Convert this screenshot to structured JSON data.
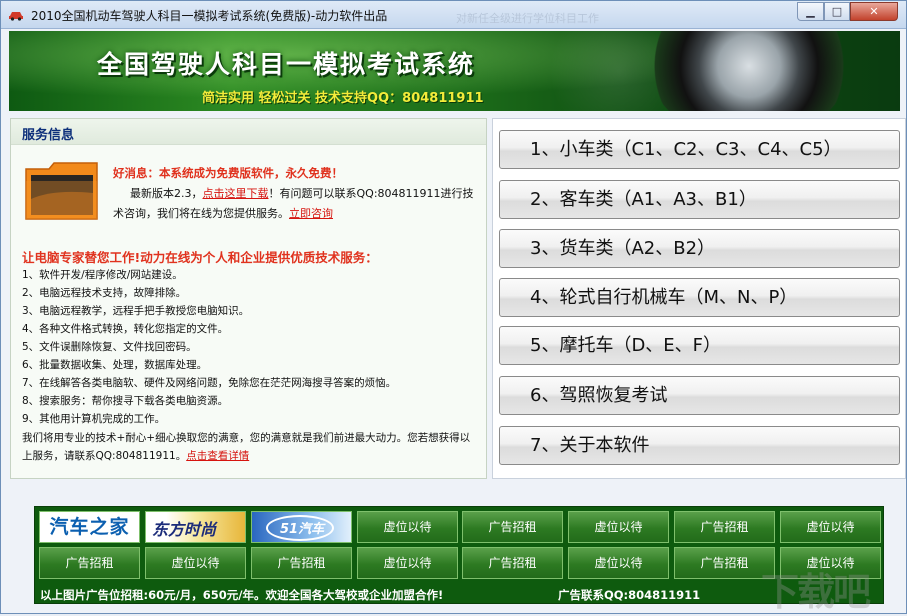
{
  "window": {
    "title": "2010全国机动车驾驶人科目一模拟考试系统(免费版)-动力软件出品",
    "ghost_text": "对新任全级进行学位科目工作",
    "close_label": "✕",
    "max_label": "□",
    "min_label": "▁"
  },
  "banner": {
    "title": "全国驾驶人科目一模拟考试系统",
    "subtitle": "简洁实用  轻松过关  技术支持QQ：804811911"
  },
  "service": {
    "header": "服务信息",
    "good_news": "好消息：本系统成为免费版软件，永久免费！",
    "para_prefix": "最新版本2.3，",
    "download_link": "点击这里下载",
    "para_middle": "！有问题可以联系QQ:804811911进行技术咨询，我们将在线为您提供服务。",
    "consult_link": "立即咨询",
    "headline": "让电脑专家替您工作!动力在线为个人和企业提供优质技术服务：",
    "items": [
      "1、软件开发/程序修改/网站建设。",
      "2、电脑远程技术支持，故障排除。",
      "3、电脑远程教学，远程手把手教授您电脑知识。",
      "4、各种文件格式转换，转化您指定的文件。",
      "5、文件误删除恢复、文件找回密码。",
      "6、批量数据收集、处理，数据库处理。",
      "7、在线解答各类电脑软、硬件及网络问题，免除您在茫茫网海搜寻答案的烦恼。",
      "8、搜索服务：帮你搜寻下载各类电脑资源。",
      "9、其他用计算机完成的工作。"
    ],
    "closing": "我们将用专业的技术+耐心+细心换取您的满意，您的满意就是我们前进最大动力。您若想获得以上服务，请联系QQ:804811911。",
    "details_link": "点击查看详情"
  },
  "menu": {
    "buttons": [
      "1、小车类（C1、C2、C3、C4、C5）",
      "2、客车类（A1、A3、B1）",
      "3、货车类（A2、B2）",
      "4、轮式自行机械车（M、N、P）",
      "5、摩托车（D、E、F）",
      "6、驾照恢复考试",
      "7、关于本软件"
    ]
  },
  "ads": {
    "logos": [
      "汽车之家",
      "东方时尚",
      "51汽车"
    ],
    "row1": [
      "虚位以待",
      "广告招租",
      "虚位以待",
      "广告招租",
      "虚位以待"
    ],
    "row2": [
      "广告招租",
      "虚位以待",
      "广告招租",
      "虚位以待",
      "广告招租",
      "虚位以待",
      "广告招租",
      "虚位以待"
    ],
    "footer_left": "以上图片广告位招租:60元/月，650元/年。欢迎全国各大驾校或企业加盟合作!",
    "footer_right": "广告联系QQ:804811911"
  },
  "watermark": "下载吧"
}
